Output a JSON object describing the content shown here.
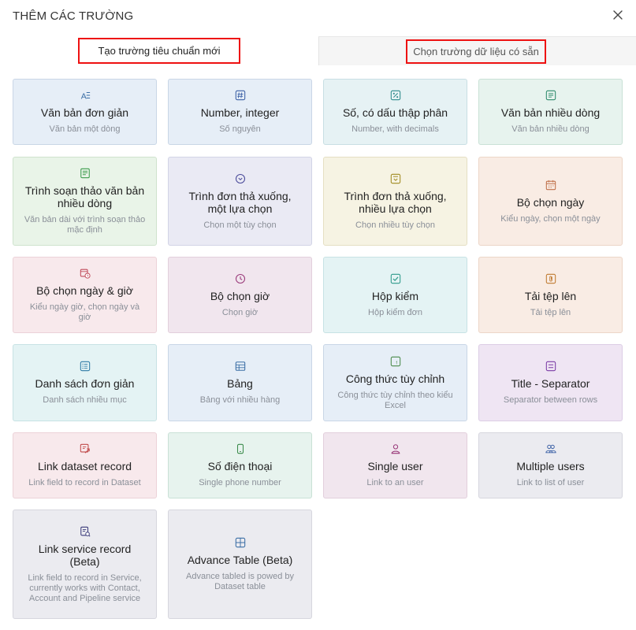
{
  "header": {
    "title": "THÊM CÁC TRƯỜNG"
  },
  "tabs": [
    {
      "label": "Tạo trường tiêu chuẩn mới",
      "active": true
    },
    {
      "label": "Chọn trường dữ liệu có sẵn",
      "active": false
    }
  ],
  "colors": {
    "highlight": "#ee1111",
    "icon_blue": "#3a6ea5"
  },
  "cards": [
    {
      "title": "Văn bản đơn giản",
      "desc": "Văn bản một dòng",
      "icon": "text-icon",
      "iconColor": "#3a6ea5"
    },
    {
      "title": "Number, integer",
      "desc": "Số nguyên",
      "icon": "hash-icon",
      "iconColor": "#3a5fa5"
    },
    {
      "title": "Số, có dấu thập phân",
      "desc": "Number, with decimals",
      "icon": "percent-icon",
      "iconColor": "#2d8a8a"
    },
    {
      "title": "Văn bản nhiều dòng",
      "desc": "Văn bản nhiều dòng",
      "icon": "multiline-icon",
      "iconColor": "#2d8a6a"
    },
    {
      "title": "Trình soạn thảo văn bản nhiều dòng",
      "desc": "Văn bản dài với trình soạn thảo mặc định",
      "icon": "editor-icon",
      "iconColor": "#3a9a4a"
    },
    {
      "title": "Trình đơn thả xuống, một lựa chọn",
      "desc": "Chọn một tùy chọn",
      "icon": "chevron-circle-icon",
      "iconColor": "#4a4a9a"
    },
    {
      "title": "Trình đơn thả xuống, nhiều lựa chọn",
      "desc": "Chọn nhiều tùy chọn",
      "icon": "multi-select-icon",
      "iconColor": "#a08a20"
    },
    {
      "title": "Bộ chọn ngày",
      "desc": "Kiểu ngày, chọn một ngày",
      "icon": "calendar-icon",
      "iconColor": "#c0704a"
    },
    {
      "title": "Bộ chọn ngày & giờ",
      "desc": "Kiểu ngày giờ, chọn ngày và giờ",
      "icon": "calendar-clock-icon",
      "iconColor": "#c04a5a"
    },
    {
      "title": "Bộ chọn giờ",
      "desc": "Chọn giờ",
      "icon": "clock-icon",
      "iconColor": "#9a3a7a"
    },
    {
      "title": "Hộp kiểm",
      "desc": "Hộp kiểm đơn",
      "icon": "checkbox-icon",
      "iconColor": "#2d9a8a"
    },
    {
      "title": "Tải tệp lên",
      "desc": "Tải tệp lên",
      "icon": "paperclip-icon",
      "iconColor": "#c07a30"
    },
    {
      "title": "Danh sách đơn giản",
      "desc": "Danh sách nhiều mục",
      "icon": "list-icon",
      "iconColor": "#2d7aa5"
    },
    {
      "title": "Bảng",
      "desc": "Bảng với nhiều hàng",
      "icon": "table-icon",
      "iconColor": "#3a6ea5"
    },
    {
      "title": "Công thức tùy chỉnh",
      "desc": "Công thức tùy chỉnh theo kiểu Excel",
      "icon": "formula-icon",
      "iconColor": "#4a8a4a"
    },
    {
      "title": "Title - Separator",
      "desc": "Separator between rows",
      "icon": "separator-icon",
      "iconColor": "#7a3aa5"
    },
    {
      "title": "Link dataset record",
      "desc": "Link field to record in Dataset",
      "icon": "link-dataset-icon",
      "iconColor": "#c04a4a"
    },
    {
      "title": "Số điện thoại",
      "desc": "Single phone number",
      "icon": "phone-icon",
      "iconColor": "#3a8a4a"
    },
    {
      "title": "Single user",
      "desc": "Link to an user",
      "icon": "user-icon",
      "iconColor": "#9a3a7a"
    },
    {
      "title": "Multiple users",
      "desc": "Link to list of user",
      "icon": "users-icon",
      "iconColor": "#3a5fa5"
    },
    {
      "title": "Link service record (Beta)",
      "desc": "Link field to record in Service, currently works with Contact, Account and Pipeline service",
      "icon": "link-service-icon",
      "iconColor": "#3a3a7a"
    },
    {
      "title": "Advance Table (Beta)",
      "desc": "Advance tabled is powed by Dataset table",
      "icon": "grid-icon",
      "iconColor": "#3a6ea5"
    }
  ]
}
